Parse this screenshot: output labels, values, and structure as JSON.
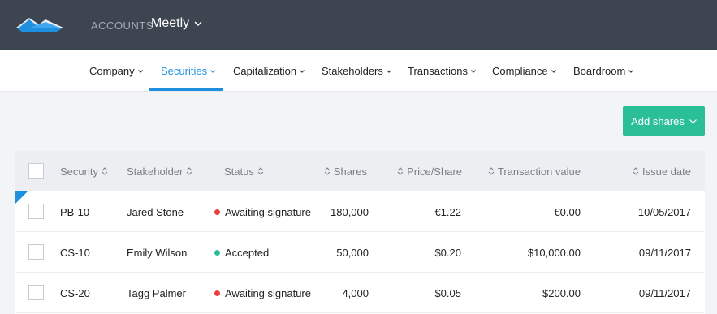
{
  "header": {
    "accounts_label": "ACCOUNTS",
    "account_name": "Meetly"
  },
  "nav": {
    "items": [
      {
        "label": "Company"
      },
      {
        "label": "Securities",
        "active": true
      },
      {
        "label": "Capitalization"
      },
      {
        "label": "Stakeholders"
      },
      {
        "label": "Transactions"
      },
      {
        "label": "Compliance"
      },
      {
        "label": "Boardroom"
      }
    ]
  },
  "actions": {
    "add_shares": "Add shares"
  },
  "table": {
    "columns": {
      "security": "Security",
      "stakeholder": "Stakeholder",
      "status": "Status",
      "shares": "Shares",
      "price_share": "Price/Share",
      "transaction_value": "Transaction value",
      "issue_date": "Issue date"
    },
    "rows": [
      {
        "security": "PB-10",
        "stakeholder": "Jared Stone",
        "status": "Awaiting signature",
        "shares": "180,000",
        "price": "€1.22",
        "value": "€0.00",
        "date": "10/05/2017"
      },
      {
        "security": "CS-10",
        "stakeholder": "Emily Wilson",
        "status": "Accepted",
        "shares": "50,000",
        "price": "$0.20",
        "value": "$10,000.00",
        "date": "09/11/2017"
      },
      {
        "security": "CS-20",
        "stakeholder": "Tagg Palmer",
        "status": "Awaiting signature",
        "shares": "4,000",
        "price": "$0.05",
        "value": "$200.00",
        "date": "09/11/2017"
      }
    ]
  },
  "colors": {
    "topbar": "#3c4550",
    "accent": "#1f8fe0",
    "button": "#2bbf98",
    "status_awaiting": "#e8413c",
    "status_accepted": "#2bbf98"
  }
}
